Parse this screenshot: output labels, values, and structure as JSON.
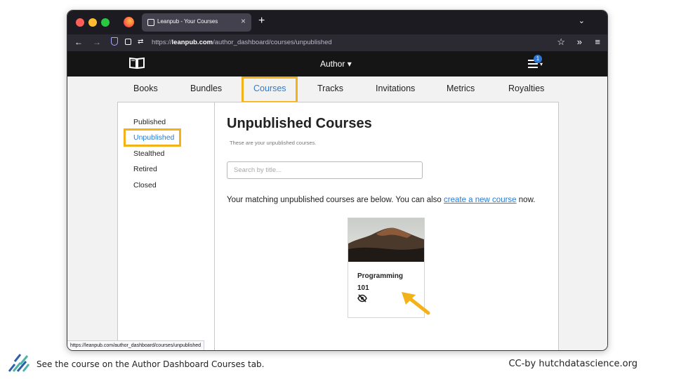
{
  "browser": {
    "tab_title": "Leanpub - Your Courses",
    "tab_close": "×",
    "new_tab": "+",
    "url_prefix": "https://",
    "url_host": "leanpub.com",
    "url_path": "/author_dashboard/courses/unpublished",
    "status_url": "https://leanpub.com/author_dashboard/courses/unpublished",
    "icons": [
      "firefox-icon",
      "back-icon",
      "forward-icon",
      "shield-icon",
      "lock-icon",
      "permissions-icon",
      "bookmark-star-icon",
      "extensions-icon",
      "menu-icon",
      "list-all-tabs-icon"
    ]
  },
  "header": {
    "author_menu": "Author ▾",
    "notification_count": "1",
    "icons": [
      "leanpub-book-logo-icon",
      "hamburger-menu-icon"
    ]
  },
  "top_tabs": [
    {
      "label": "Books"
    },
    {
      "label": "Bundles"
    },
    {
      "label": "Courses",
      "active": true
    },
    {
      "label": "Tracks"
    },
    {
      "label": "Invitations"
    },
    {
      "label": "Metrics"
    },
    {
      "label": "Royalties"
    }
  ],
  "sidebar": {
    "items": [
      {
        "label": "Published"
      },
      {
        "label": "Unpublished",
        "active": true
      },
      {
        "label": "Stealthed"
      },
      {
        "label": "Retired"
      },
      {
        "label": "Closed"
      }
    ]
  },
  "main": {
    "title": "Unpublished Courses",
    "subtitle": "These are your unpublished courses.",
    "search_placeholder": "Search by title...",
    "match_text_before": "Your matching unpublished courses are below. You can also ",
    "match_link": "create a new course",
    "match_text_after": " now."
  },
  "courses": [
    {
      "title": "Programming 101",
      "status_icon": "eye-slash-icon"
    }
  ],
  "slide": {
    "caption": "See the course on the Author Dashboard Courses tab.",
    "credit": "CC-by hutchdatascience.org"
  },
  "colors": {
    "highlight": "#f4b21a",
    "link": "#2c7bd0",
    "header_bg": "#151515",
    "notification": "#2f76d2"
  }
}
